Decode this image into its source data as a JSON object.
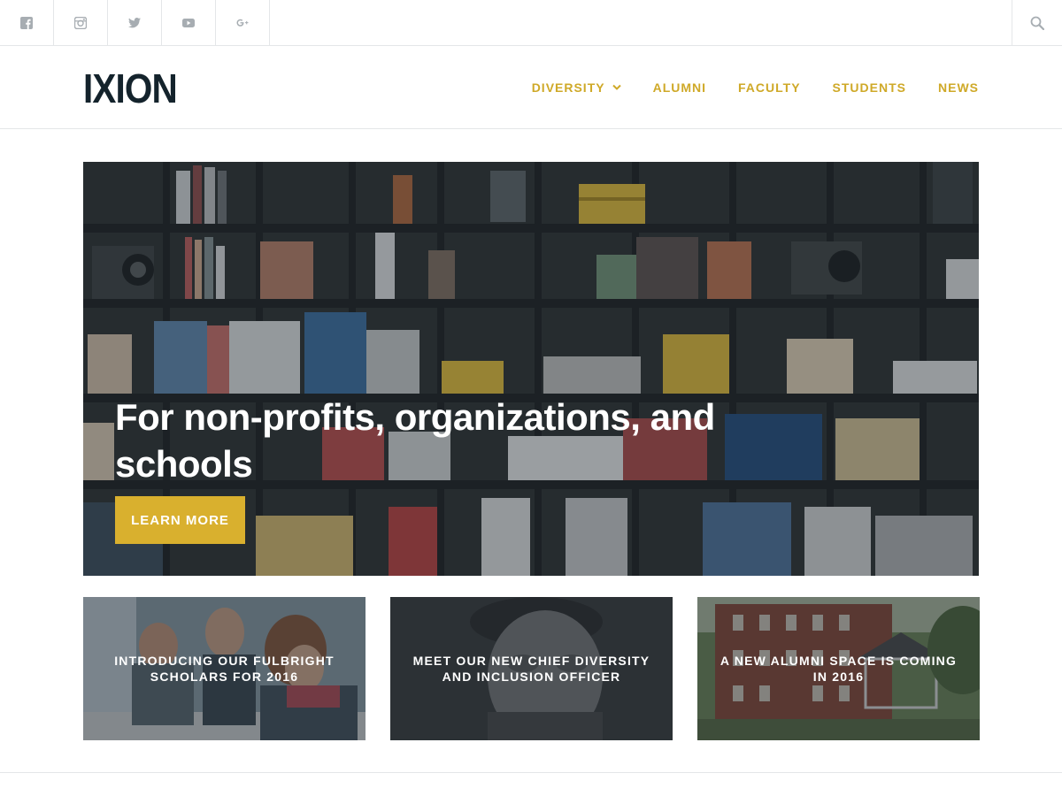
{
  "social": {
    "items": [
      {
        "icon": "facebook-icon"
      },
      {
        "icon": "instagram-icon"
      },
      {
        "icon": "twitter-icon"
      },
      {
        "icon": "youtube-icon"
      },
      {
        "icon": "google-plus-icon"
      }
    ],
    "search_icon": "search-icon"
  },
  "header": {
    "logo": "IXION",
    "nav": [
      {
        "label": "DIVERSITY",
        "has_dropdown": true
      },
      {
        "label": "ALUMNI"
      },
      {
        "label": "FACULTY"
      },
      {
        "label": "STUDENTS"
      },
      {
        "label": "NEWS"
      }
    ]
  },
  "hero": {
    "title": "For non-profits, organizations, and schools",
    "button_label": "LEARN MORE"
  },
  "cards": [
    {
      "label": "INTRODUCING OUR FULBRIGHT SCHOLARS FOR 2016"
    },
    {
      "label": "MEET OUR NEW CHIEF DIVERSITY AND INCLUSION OFFICER"
    },
    {
      "label": "A NEW ALUMNI SPACE IS COMING IN 2016"
    }
  ],
  "colors": {
    "accent": "#d9b02e",
    "nav_text": "#cfa928",
    "logo": "#14232c",
    "border": "#e4e6e8"
  }
}
